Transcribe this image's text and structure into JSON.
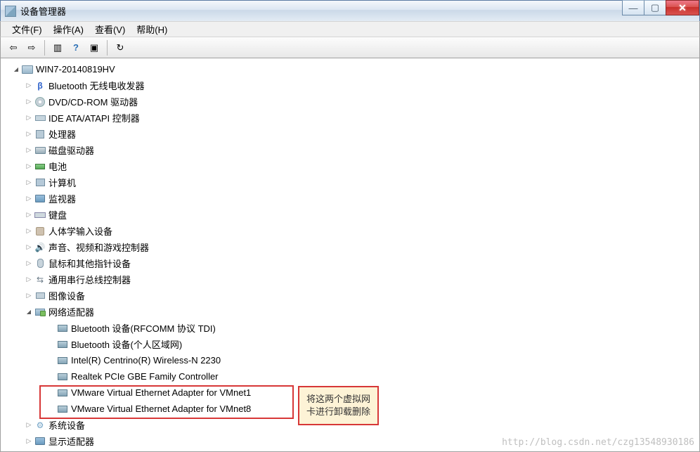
{
  "window": {
    "title": "设备管理器"
  },
  "menu": {
    "file": "文件(F)",
    "action": "操作(A)",
    "view": "查看(V)",
    "help": "帮助(H)"
  },
  "toolbar_icons": {
    "back": "back-arrow",
    "forward": "forward-arrow",
    "show_hide": "panel-toggle",
    "help": "help",
    "scan": "scan-hardware",
    "refresh": "refresh"
  },
  "tree": {
    "root": "WIN7-20140819HV",
    "categories": [
      {
        "label": "Bluetooth 无线电收发器",
        "icon": "bt"
      },
      {
        "label": "DVD/CD-ROM 驱动器",
        "icon": "disc"
      },
      {
        "label": "IDE ATA/ATAPI 控制器",
        "icon": "ide"
      },
      {
        "label": "处理器",
        "icon": "cpu"
      },
      {
        "label": "磁盘驱动器",
        "icon": "hdd"
      },
      {
        "label": "电池",
        "icon": "bat"
      },
      {
        "label": "计算机",
        "icon": "pc"
      },
      {
        "label": "监视器",
        "icon": "mon"
      },
      {
        "label": "键盘",
        "icon": "kb"
      },
      {
        "label": "人体学输入设备",
        "icon": "hid"
      },
      {
        "label": "声音、视频和游戏控制器",
        "icon": "snd"
      },
      {
        "label": "鼠标和其他指针设备",
        "icon": "mouse"
      },
      {
        "label": "通用串行总线控制器",
        "icon": "usb"
      },
      {
        "label": "图像设备",
        "icon": "cam"
      }
    ],
    "network": {
      "label": "网络适配器",
      "children": [
        "Bluetooth 设备(RFCOMM 协议 TDI)",
        "Bluetooth 设备(个人区域网)",
        "Intel(R) Centrino(R) Wireless-N 2230",
        "Realtek PCIe GBE Family Controller",
        "VMware Virtual Ethernet Adapter for VMnet1",
        "VMware Virtual Ethernet Adapter for VMnet8"
      ]
    },
    "tail": [
      {
        "label": "系统设备",
        "icon": "sys"
      },
      {
        "label": "显示适配器",
        "icon": "mon"
      }
    ]
  },
  "annotation": {
    "line1": "将这两个虚拟网",
    "line2": "卡进行卸载删除"
  },
  "watermark": "http://blog.csdn.net/czg13548930186"
}
